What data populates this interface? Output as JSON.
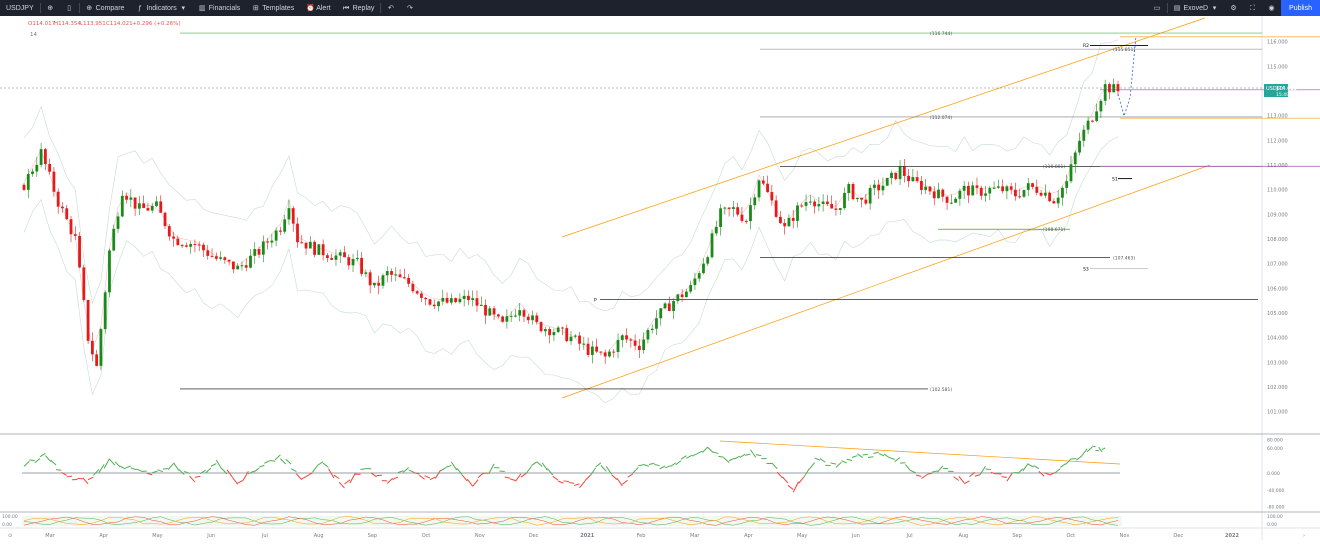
{
  "toolbar": {
    "symbol": "USDJPY",
    "items": [
      {
        "name": "compare",
        "label": "Compare"
      },
      {
        "name": "indicators",
        "label": "Indicators"
      },
      {
        "name": "financials",
        "label": "Financials"
      },
      {
        "name": "templates",
        "label": "Templates"
      },
      {
        "name": "alert",
        "label": "Alert"
      },
      {
        "name": "replay",
        "label": "Replay"
      }
    ],
    "account": "ExoveD",
    "publish_label": "Publish"
  },
  "ohlc": {
    "open": "O114.017",
    "high": "H114.354",
    "low": "L113.951",
    "close": "C114.021",
    "change": "+0.296 (+0.26%)",
    "indicator": "14"
  },
  "price_axis": [
    "116.000",
    "115.000",
    "114.000",
    "113.000",
    "112.000",
    "111.000",
    "110.000",
    "109.000",
    "108.000",
    "107.000",
    "106.000",
    "105.000",
    "104.000",
    "103.000",
    "102.000",
    "101.000"
  ],
  "last_price": {
    "symbol": "USDJPY",
    "value": "114.021",
    "countdown": "15:49:40"
  },
  "levels": [
    {
      "label": "(116.744)",
      "price": 116.35
    },
    {
      "label": "(115.851)",
      "price": 115.7
    },
    {
      "label": "(112.074)",
      "price": 112.95
    },
    {
      "label": "(110.801)",
      "price": 110.95
    },
    {
      "label": "(108.671)",
      "price": 108.4
    },
    {
      "label": "(107.463)",
      "price": 107.25
    },
    {
      "label": "(102.581)",
      "price": 101.92
    }
  ],
  "pivot_labels": {
    "r2": "R2",
    "s1": "S1",
    "s3": "S3",
    "p": "P"
  },
  "osc_axis": [
    "80.000",
    "60.000",
    "0.000",
    "-40.000",
    "-80.000"
  ],
  "osc2_axis": [
    "100.00",
    "0.00"
  ],
  "osc2_left": [
    "100.00",
    "0.00"
  ],
  "x_labels": [
    "Mar",
    "Apr",
    "May",
    "Jun",
    "Jul",
    "Aug",
    "Sep",
    "Oct",
    "Nov",
    "Dec",
    "2021",
    "Feb",
    "Mar",
    "Apr",
    "May",
    "Jun",
    "Jul",
    "Aug",
    "Sep",
    "Oct",
    "Nov",
    "Dec",
    "2022"
  ],
  "colors": {
    "up": "#26a69a",
    "down": "#ef5350",
    "osc_up": "#4caf50",
    "osc_down": "#f44336",
    "orange": "#ff9800",
    "gold": "#f5b942",
    "purple": "#ab47bc"
  },
  "chart_data": {
    "type": "candlestick",
    "symbol": "USDJPY",
    "y_range": [
      100.5,
      116.8
    ],
    "close_path": [
      [
        0,
        110.2
      ],
      [
        4,
        111.5
      ],
      [
        8,
        109.5
      ],
      [
        12,
        108.0
      ],
      [
        15,
        104.0
      ],
      [
        17,
        102.8
      ],
      [
        20,
        107.5
      ],
      [
        23,
        110.0
      ],
      [
        27,
        109.2
      ],
      [
        31,
        109.3
      ],
      [
        35,
        108.0
      ],
      [
        40,
        107.8
      ],
      [
        45,
        107.2
      ],
      [
        50,
        106.8
      ],
      [
        55,
        107.5
      ],
      [
        60,
        108.5
      ],
      [
        62,
        109.5
      ],
      [
        64,
        108.0
      ],
      [
        68,
        107.6
      ],
      [
        73,
        107.3
      ],
      [
        78,
        107.0
      ],
      [
        82,
        106.0
      ],
      [
        85,
        106.6
      ],
      [
        90,
        106.2
      ],
      [
        95,
        105.5
      ],
      [
        100,
        105.4
      ],
      [
        104,
        105.6
      ],
      [
        108,
        105.1
      ],
      [
        112,
        104.5
      ],
      [
        116,
        105.3
      ],
      [
        120,
        104.5
      ],
      [
        124,
        104.3
      ],
      [
        128,
        104.0
      ],
      [
        132,
        103.5
      ],
      [
        136,
        103.2
      ],
      [
        140,
        104.0
      ],
      [
        144,
        103.7
      ],
      [
        148,
        104.8
      ],
      [
        152,
        105.5
      ],
      [
        156,
        106.0
      ],
      [
        160,
        107.5
      ],
      [
        163,
        109.0
      ],
      [
        166,
        109.2
      ],
      [
        169,
        108.8
      ],
      [
        172,
        110.5
      ],
      [
        175,
        109.5
      ],
      [
        178,
        108.4
      ],
      [
        181,
        109.2
      ],
      [
        184,
        109.7
      ],
      [
        187,
        109.3
      ],
      [
        190,
        109.2
      ],
      [
        193,
        110.0
      ],
      [
        196,
        109.5
      ],
      [
        199,
        110.0
      ],
      [
        202,
        110.3
      ],
      [
        205,
        110.8
      ],
      [
        208,
        110.3
      ],
      [
        211,
        110.1
      ],
      [
        214,
        109.8
      ],
      [
        217,
        109.6
      ],
      [
        220,
        110.0
      ],
      [
        223,
        109.9
      ],
      [
        226,
        110.0
      ],
      [
        229,
        110.0
      ],
      [
        232,
        109.8
      ],
      [
        235,
        110.1
      ],
      [
        238,
        110.0
      ],
      [
        241,
        109.6
      ],
      [
        244,
        110.3
      ],
      [
        247,
        112.0
      ],
      [
        250,
        113.0
      ],
      [
        253,
        114.2
      ],
      [
        256,
        114.0
      ]
    ],
    "oscillator_path": [
      [
        0,
        20
      ],
      [
        5,
        40
      ],
      [
        10,
        -10
      ],
      [
        15,
        -20
      ],
      [
        20,
        30
      ],
      [
        25,
        10
      ],
      [
        30,
        -5
      ],
      [
        35,
        20
      ],
      [
        40,
        -15
      ],
      [
        45,
        25
      ],
      [
        50,
        -20
      ],
      [
        55,
        15
      ],
      [
        60,
        40
      ],
      [
        65,
        -10
      ],
      [
        70,
        20
      ],
      [
        75,
        -30
      ],
      [
        80,
        15
      ],
      [
        85,
        -20
      ],
      [
        90,
        10
      ],
      [
        95,
        -15
      ],
      [
        100,
        20
      ],
      [
        105,
        -25
      ],
      [
        110,
        15
      ],
      [
        115,
        -20
      ],
      [
        120,
        30
      ],
      [
        125,
        -15
      ],
      [
        130,
        -30
      ],
      [
        135,
        20
      ],
      [
        140,
        -25
      ],
      [
        145,
        25
      ],
      [
        150,
        10
      ],
      [
        155,
        40
      ],
      [
        160,
        55
      ],
      [
        165,
        30
      ],
      [
        170,
        50
      ],
      [
        175,
        20
      ],
      [
        180,
        -40
      ],
      [
        185,
        30
      ],
      [
        190,
        20
      ],
      [
        195,
        40
      ],
      [
        200,
        45
      ],
      [
        205,
        30
      ],
      [
        210,
        -10
      ],
      [
        215,
        15
      ],
      [
        220,
        -20
      ],
      [
        225,
        10
      ],
      [
        230,
        -15
      ],
      [
        235,
        20
      ],
      [
        240,
        -10
      ],
      [
        245,
        30
      ],
      [
        250,
        60
      ],
      [
        253,
        55
      ]
    ]
  }
}
